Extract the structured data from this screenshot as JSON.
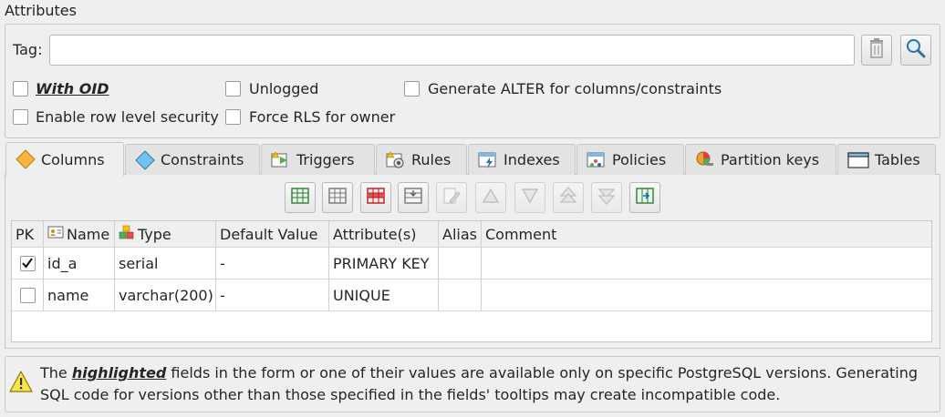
{
  "attributes": {
    "title": "Attributes",
    "tag_label": "Tag:",
    "tag_value": "",
    "checkboxes": {
      "with_oid": {
        "label": "With OID",
        "checked": false
      },
      "unlogged": {
        "label": "Unlogged",
        "checked": false
      },
      "generate_alter": {
        "label": "Generate ALTER for columns/constraints",
        "checked": false
      },
      "row_level_security": {
        "label": "Enable row level security",
        "checked": false
      },
      "force_rls": {
        "label": "Force RLS for owner",
        "checked": false
      }
    }
  },
  "tabs": [
    {
      "label": "Columns",
      "active": true
    },
    {
      "label": "Constraints",
      "active": false
    },
    {
      "label": "Triggers",
      "active": false
    },
    {
      "label": "Rules",
      "active": false
    },
    {
      "label": "Indexes",
      "active": false
    },
    {
      "label": "Policies",
      "active": false
    },
    {
      "label": "Partition keys",
      "active": false
    },
    {
      "label": "Tables",
      "active": false
    }
  ],
  "columns_table": {
    "headers": [
      "PK",
      "Name",
      "Type",
      "Default Value",
      "Attribute(s)",
      "Alias",
      "Comment"
    ],
    "rows": [
      {
        "pk": true,
        "name": "id_a",
        "type": "serial",
        "default": "-",
        "attributes": "PRIMARY KEY",
        "alias": "",
        "comment": ""
      },
      {
        "pk": false,
        "name": "name",
        "type": "varchar(200)",
        "default": "-",
        "attributes": "UNIQUE",
        "alias": "",
        "comment": ""
      }
    ]
  },
  "warning": {
    "prefix": "The ",
    "highlight": "highlighted",
    "line1_rest": " fields in the form or one of their values are available only on specific PostgreSQL versions. Generating",
    "line2": "SQL code for versions other than those specified in the fields' tooltips may create incompatible code."
  }
}
